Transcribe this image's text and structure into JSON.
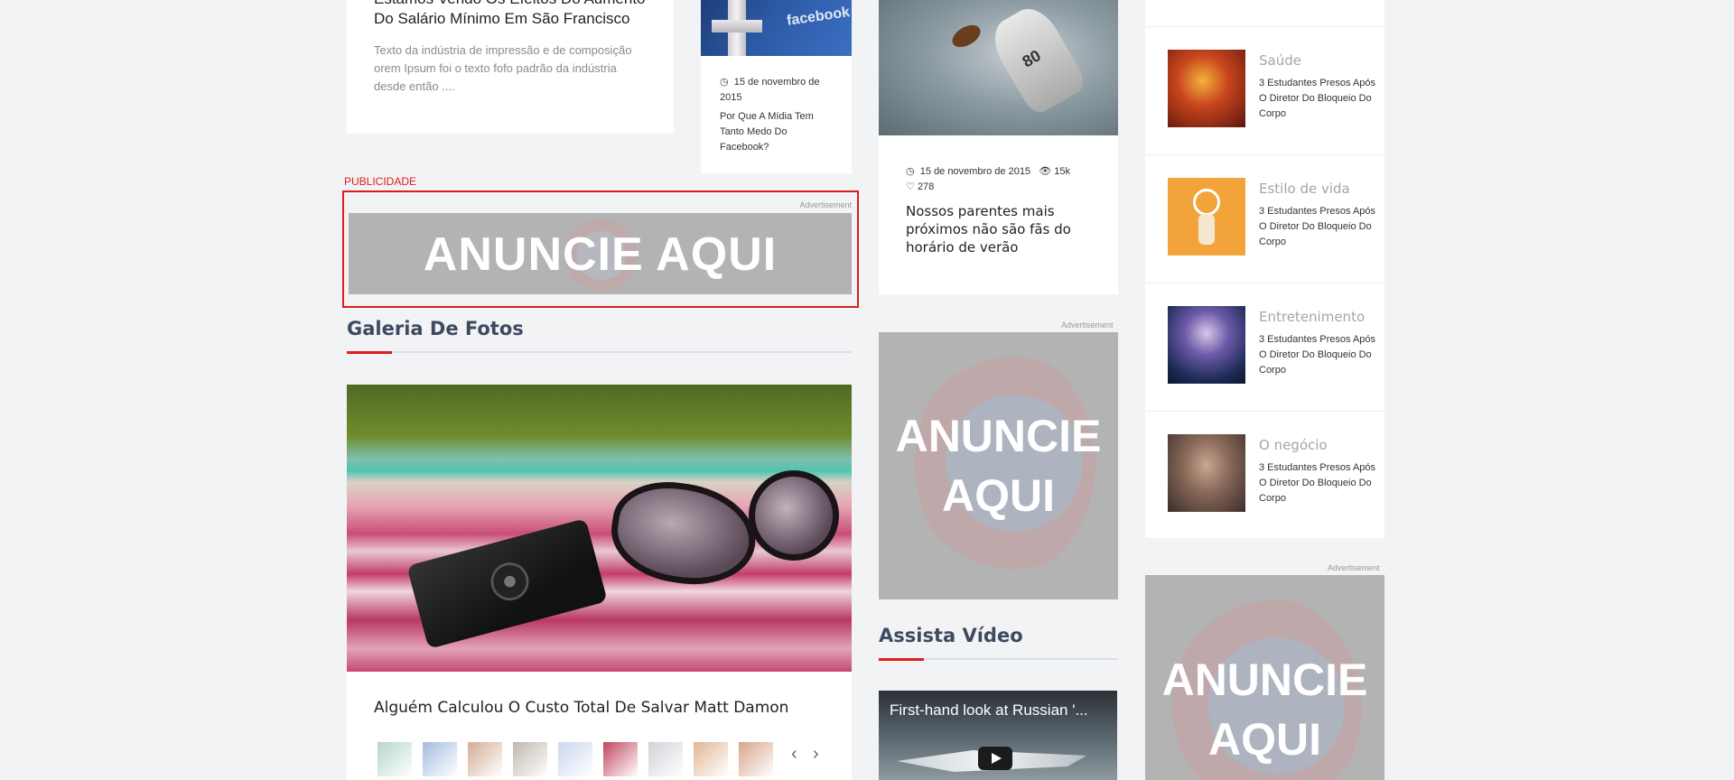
{
  "column1": {
    "top_article": {
      "title": "Estamos Vendo Os Efeitos Do Aumento Do Salário Mínimo Em São Francisco",
      "excerpt": "Texto da indústria de impressão e de composição orem Ipsum foi o texto fofo padrão da indústria desde então ...."
    },
    "small_article": {
      "thumb_text": "facebook",
      "date": "15 de novembro de 2015",
      "title": "Por Que A Mídia Tem Tanto Medo Do Facebook?"
    },
    "publicidade_label": "PUBLICIDADE",
    "banner": {
      "advertisement": "Advertisement",
      "text": "ANUNCIE AQUI"
    },
    "gallery": {
      "section_title": "Galeria De Fotos",
      "caption": "Alguém Calculou O Custo Total De Salvar Matt Damon",
      "prev_icon": "chevron-left-icon",
      "next_icon": "chevron-right-icon",
      "thumbnails": [
        {
          "color": "#7ab3a0",
          "active": false
        },
        {
          "color": "#5b86c4",
          "active": false
        },
        {
          "color": "#b06a3e",
          "active": false
        },
        {
          "color": "#8a7f6a",
          "active": false
        },
        {
          "color": "#9fb7e0",
          "active": false
        },
        {
          "color": "#c0455f",
          "active": true
        },
        {
          "color": "#a9aeb7",
          "active": false
        },
        {
          "color": "#c97a3c",
          "active": false
        },
        {
          "color": "#b85c2a",
          "active": false
        }
      ]
    }
  },
  "column2": {
    "article": {
      "jersey_number": "80",
      "date": "15 de novembro de 2015",
      "views": "15k",
      "likes": "278",
      "title": "Nossos parentes mais próximos não são fãs do horário de verão"
    },
    "ad": {
      "advertisement": "Advertisement",
      "line1": "ANUNCIE",
      "line2": "AQUI"
    },
    "video": {
      "section_title": "Assista Vídeo",
      "title": "First-hand look at Russian '..."
    }
  },
  "column3": {
    "items": [
      {
        "category": "Saúde",
        "title": "3 Estudantes Presos Após O Diretor Do Bloqueio Do Corpo",
        "color": "#b5341c"
      },
      {
        "category": "Estilo de vida",
        "title": "3 Estudantes Presos Após O Diretor Do Bloqueio Do Corpo",
        "color": "#f2a43a"
      },
      {
        "category": "Entretenimento",
        "title": "3 Estudantes Presos Após O Diretor Do Bloqueio Do Corpo",
        "color": "#3d4a8a"
      },
      {
        "category": "O negócio",
        "title": "3 Estudantes Presos Após O Diretor Do Bloqueio Do Corpo",
        "color": "#6d5a55"
      }
    ],
    "ad": {
      "advertisement": "Advertisement",
      "line1": "ANUNCIE",
      "line2": "AQUI"
    }
  },
  "colors": {
    "accent_red": "#e01b1b",
    "page_background": "#f2f3f5",
    "ad_gray": "#b3b3b3"
  }
}
